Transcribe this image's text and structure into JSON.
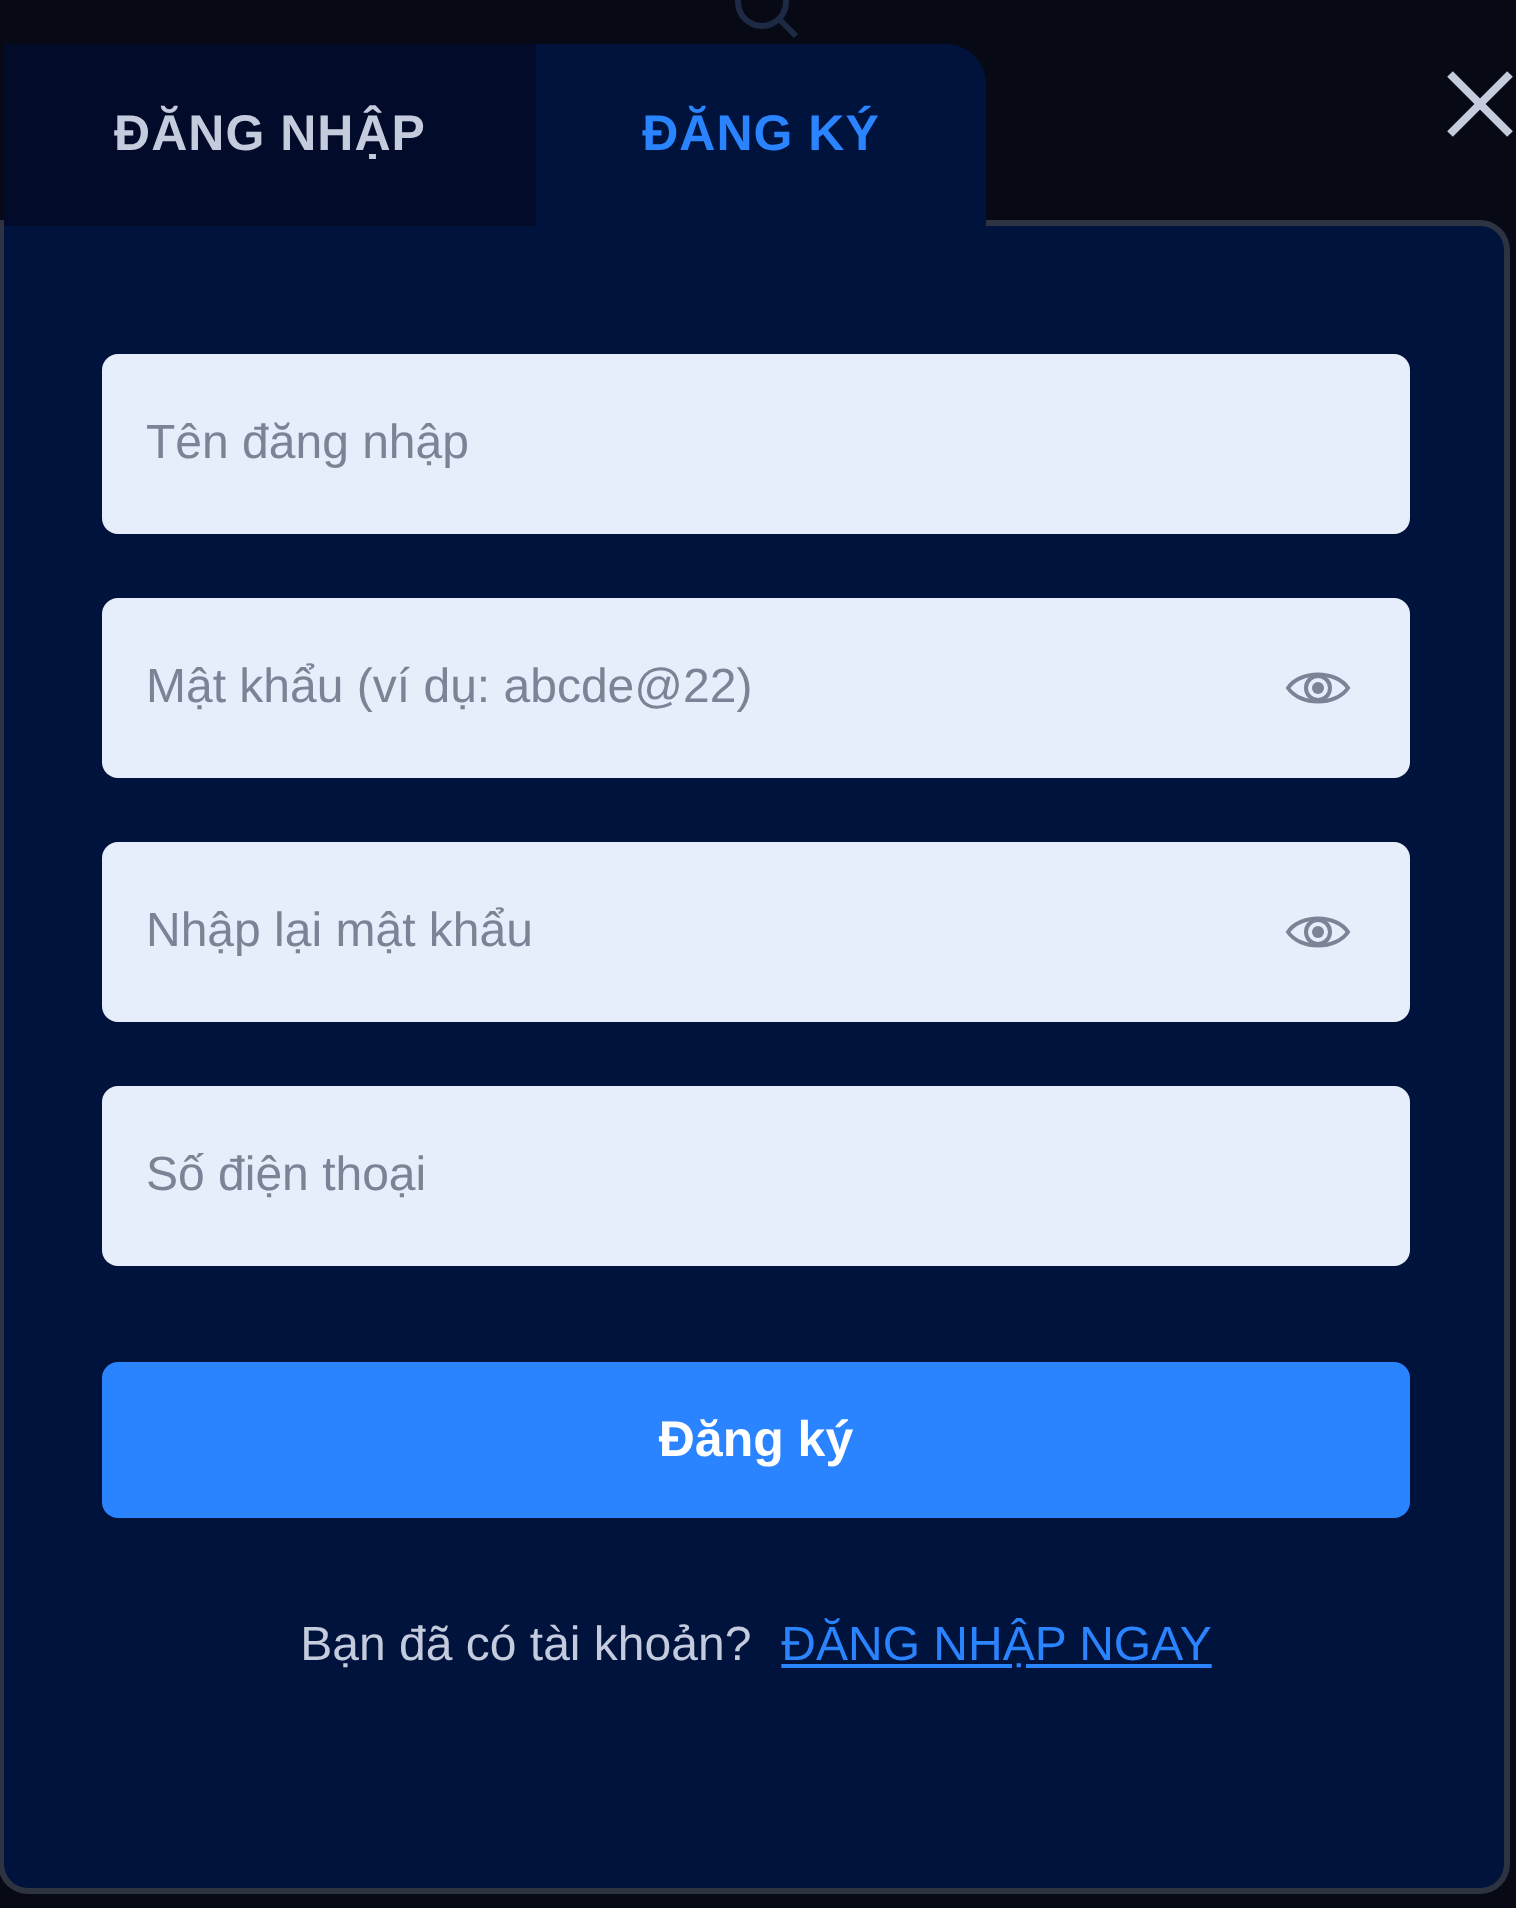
{
  "tabs": [
    {
      "label": "ĐĂNG NHẬP",
      "selected": false
    },
    {
      "label": "ĐĂNG KÝ",
      "selected": true
    }
  ],
  "fields": [
    {
      "placeholder": "Tên đăng nhập",
      "kind": "text"
    },
    {
      "placeholder": "Mật khẩu (ví dụ: abcde@22)",
      "kind": "password"
    },
    {
      "placeholder": "Nhập lại mật khẩu",
      "kind": "password"
    },
    {
      "placeholder": "Số điện thoại",
      "kind": "text"
    }
  ],
  "submit": "Đăng ký",
  "footer": {
    "text": "Bạn đã có tài khoản?",
    "link": "ĐĂNG NHẬP NGAY"
  }
}
